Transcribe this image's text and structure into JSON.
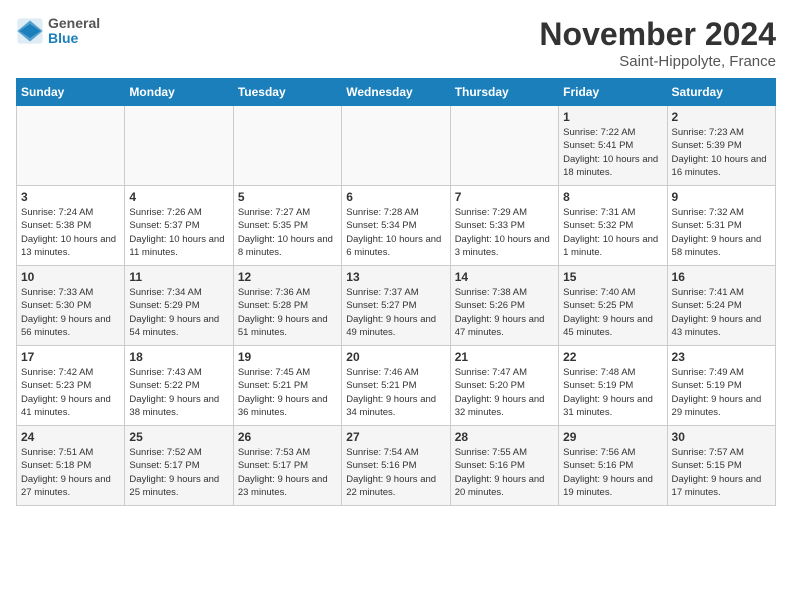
{
  "header": {
    "logo_line1": "General",
    "logo_line2": "Blue",
    "month_title": "November 2024",
    "location": "Saint-Hippolyte, France"
  },
  "days_of_week": [
    "Sunday",
    "Monday",
    "Tuesday",
    "Wednesday",
    "Thursday",
    "Friday",
    "Saturday"
  ],
  "weeks": [
    [
      {
        "day": "",
        "text": ""
      },
      {
        "day": "",
        "text": ""
      },
      {
        "day": "",
        "text": ""
      },
      {
        "day": "",
        "text": ""
      },
      {
        "day": "",
        "text": ""
      },
      {
        "day": "1",
        "text": "Sunrise: 7:22 AM\nSunset: 5:41 PM\nDaylight: 10 hours and 18 minutes."
      },
      {
        "day": "2",
        "text": "Sunrise: 7:23 AM\nSunset: 5:39 PM\nDaylight: 10 hours and 16 minutes."
      }
    ],
    [
      {
        "day": "3",
        "text": "Sunrise: 7:24 AM\nSunset: 5:38 PM\nDaylight: 10 hours and 13 minutes."
      },
      {
        "day": "4",
        "text": "Sunrise: 7:26 AM\nSunset: 5:37 PM\nDaylight: 10 hours and 11 minutes."
      },
      {
        "day": "5",
        "text": "Sunrise: 7:27 AM\nSunset: 5:35 PM\nDaylight: 10 hours and 8 minutes."
      },
      {
        "day": "6",
        "text": "Sunrise: 7:28 AM\nSunset: 5:34 PM\nDaylight: 10 hours and 6 minutes."
      },
      {
        "day": "7",
        "text": "Sunrise: 7:29 AM\nSunset: 5:33 PM\nDaylight: 10 hours and 3 minutes."
      },
      {
        "day": "8",
        "text": "Sunrise: 7:31 AM\nSunset: 5:32 PM\nDaylight: 10 hours and 1 minute."
      },
      {
        "day": "9",
        "text": "Sunrise: 7:32 AM\nSunset: 5:31 PM\nDaylight: 9 hours and 58 minutes."
      }
    ],
    [
      {
        "day": "10",
        "text": "Sunrise: 7:33 AM\nSunset: 5:30 PM\nDaylight: 9 hours and 56 minutes."
      },
      {
        "day": "11",
        "text": "Sunrise: 7:34 AM\nSunset: 5:29 PM\nDaylight: 9 hours and 54 minutes."
      },
      {
        "day": "12",
        "text": "Sunrise: 7:36 AM\nSunset: 5:28 PM\nDaylight: 9 hours and 51 minutes."
      },
      {
        "day": "13",
        "text": "Sunrise: 7:37 AM\nSunset: 5:27 PM\nDaylight: 9 hours and 49 minutes."
      },
      {
        "day": "14",
        "text": "Sunrise: 7:38 AM\nSunset: 5:26 PM\nDaylight: 9 hours and 47 minutes."
      },
      {
        "day": "15",
        "text": "Sunrise: 7:40 AM\nSunset: 5:25 PM\nDaylight: 9 hours and 45 minutes."
      },
      {
        "day": "16",
        "text": "Sunrise: 7:41 AM\nSunset: 5:24 PM\nDaylight: 9 hours and 43 minutes."
      }
    ],
    [
      {
        "day": "17",
        "text": "Sunrise: 7:42 AM\nSunset: 5:23 PM\nDaylight: 9 hours and 41 minutes."
      },
      {
        "day": "18",
        "text": "Sunrise: 7:43 AM\nSunset: 5:22 PM\nDaylight: 9 hours and 38 minutes."
      },
      {
        "day": "19",
        "text": "Sunrise: 7:45 AM\nSunset: 5:21 PM\nDaylight: 9 hours and 36 minutes."
      },
      {
        "day": "20",
        "text": "Sunrise: 7:46 AM\nSunset: 5:21 PM\nDaylight: 9 hours and 34 minutes."
      },
      {
        "day": "21",
        "text": "Sunrise: 7:47 AM\nSunset: 5:20 PM\nDaylight: 9 hours and 32 minutes."
      },
      {
        "day": "22",
        "text": "Sunrise: 7:48 AM\nSunset: 5:19 PM\nDaylight: 9 hours and 31 minutes."
      },
      {
        "day": "23",
        "text": "Sunrise: 7:49 AM\nSunset: 5:19 PM\nDaylight: 9 hours and 29 minutes."
      }
    ],
    [
      {
        "day": "24",
        "text": "Sunrise: 7:51 AM\nSunset: 5:18 PM\nDaylight: 9 hours and 27 minutes."
      },
      {
        "day": "25",
        "text": "Sunrise: 7:52 AM\nSunset: 5:17 PM\nDaylight: 9 hours and 25 minutes."
      },
      {
        "day": "26",
        "text": "Sunrise: 7:53 AM\nSunset: 5:17 PM\nDaylight: 9 hours and 23 minutes."
      },
      {
        "day": "27",
        "text": "Sunrise: 7:54 AM\nSunset: 5:16 PM\nDaylight: 9 hours and 22 minutes."
      },
      {
        "day": "28",
        "text": "Sunrise: 7:55 AM\nSunset: 5:16 PM\nDaylight: 9 hours and 20 minutes."
      },
      {
        "day": "29",
        "text": "Sunrise: 7:56 AM\nSunset: 5:16 PM\nDaylight: 9 hours and 19 minutes."
      },
      {
        "day": "30",
        "text": "Sunrise: 7:57 AM\nSunset: 5:15 PM\nDaylight: 9 hours and 17 minutes."
      }
    ]
  ]
}
